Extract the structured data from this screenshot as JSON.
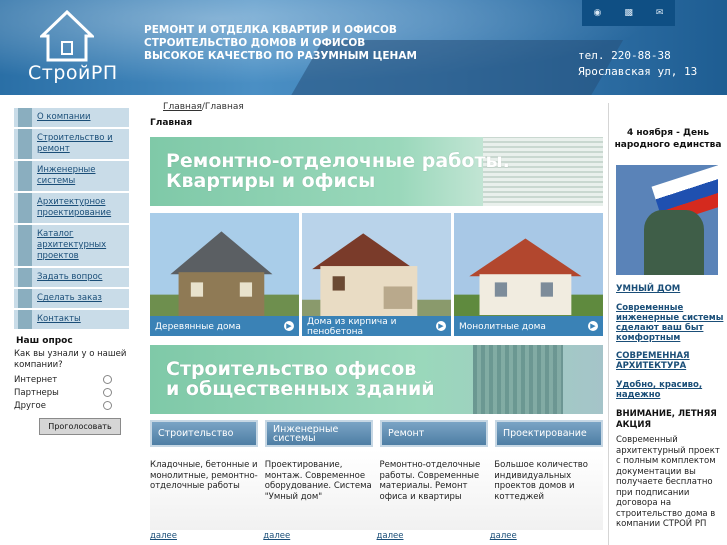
{
  "header": {
    "logo_text": "СтройРП",
    "slogan_lines": [
      "РЕМОНТ И ОТДЕЛКА КВАРТИР И ОФИСОВ",
      "СТРОИТЕЛЬСТВО ДОМОВ И ОФИСОВ",
      "ВЫСОКОЕ КАЧЕСТВО ПО РАЗУМНЫМ ЦЕНАМ"
    ],
    "phone": "тел. 220-88-38",
    "address": "Ярославская ул, 13",
    "top_icons": [
      "home-icon",
      "sitemap-icon",
      "mail-icon"
    ]
  },
  "sidebar": {
    "items": [
      "О компании",
      "Строительство и ремонт",
      "Инженерные системы",
      "Архитектурное проектирование",
      "Каталог архитектурных проектов",
      "Задать вопрос",
      "Сделать заказ",
      "Контакты"
    ]
  },
  "poll": {
    "title": "Наш опрос",
    "question": "Как вы узнали у о нашей компании?",
    "options": [
      "Интернет",
      "Партнеры",
      "Другое"
    ],
    "vote_label": "Проголосовать"
  },
  "main": {
    "breadcrumb_link": "Главная",
    "breadcrumb_current": "/Главная",
    "title": "Главная",
    "banner1": "Ремонтно-отделочные работы.\nКвартиры и офисы",
    "banner2": "Строительство офисов\nи общественных зданий",
    "photos": [
      "Деревянные дома",
      "Дома из кирпича и пенобетона",
      "Монолитные дома"
    ],
    "tabs": [
      "Строительство",
      "Инженерные системы",
      "Ремонт",
      "Проектирование"
    ],
    "columns": [
      "Кладочные, бетонные и монолитные, ремонтно-отделочные работы",
      "Проектирование, монтаж. Современное оборудование. Система \"Умный дом\"",
      "Ремонтно-отделочные работы. Современные материалы. Ремонт офиса и квартиры",
      "Большое количество индивидуальных проектов домов и коттеджей"
    ],
    "more_label": "далее"
  },
  "right": {
    "news_title": "4 ноября  - День народного единства",
    "link1": "УМНЫЙ ДОМ",
    "link2": "Современные инженерные системы сделают ваш быт комфортным",
    "link3": "СОВРЕМЕННАЯ АРХИТЕКТУРА",
    "link4": "Удобно, красиво, надежно",
    "promo_title": "ВНИМАНИЕ, ЛЕТНЯЯ АКЦИЯ",
    "promo_text": "Современный архитектурный проект с полным комплектом документации вы получаете бесплатно при подписании договора на строительство дома в компании СТРОЙ РП"
  }
}
